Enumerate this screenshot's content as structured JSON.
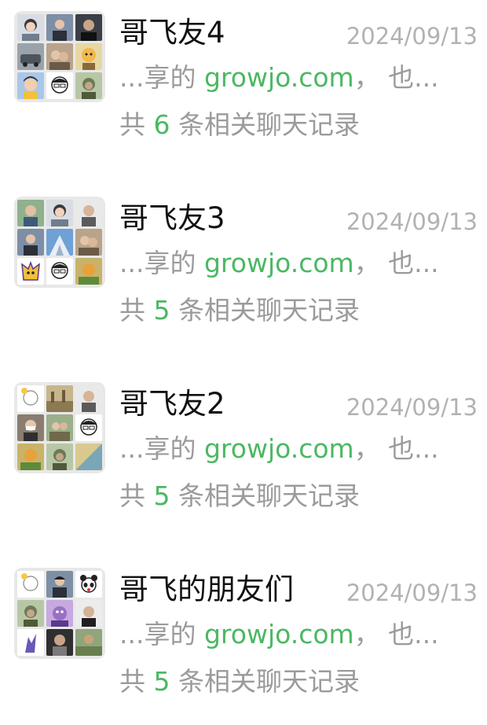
{
  "colors": {
    "highlight": "#4bb862",
    "secondary_text": "#9b9b9b",
    "date_text": "#b2b2b2",
    "title_text": "#111111",
    "avatar_bg": "#e8e8e8"
  },
  "results": [
    {
      "title": "哥飞友4",
      "date": "2024/09/13",
      "snippet_prefix": "...享的 ",
      "snippet_link": "growjo.com",
      "snippet_suffix": "， 也...",
      "count_prefix": "共 ",
      "count": "6",
      "count_suffix": " 条相关聊天记录",
      "avatar_icons": [
        "member-avatar-icon",
        "member-avatar-icon",
        "member-avatar-icon",
        "member-avatar-icon",
        "member-avatar-icon",
        "member-avatar-icon",
        "member-avatar-icon",
        "member-avatar-icon",
        "member-avatar-icon"
      ]
    },
    {
      "title": "哥飞友3",
      "date": "2024/09/13",
      "snippet_prefix": "...享的 ",
      "snippet_link": "growjo.com",
      "snippet_suffix": "， 也...",
      "count_prefix": "共 ",
      "count": "5",
      "count_suffix": " 条相关聊天记录",
      "avatar_icons": [
        "member-avatar-icon",
        "member-avatar-icon",
        "member-avatar-icon",
        "member-avatar-icon",
        "member-avatar-icon",
        "member-avatar-icon",
        "member-avatar-icon",
        "member-avatar-icon",
        "member-avatar-icon"
      ]
    },
    {
      "title": "哥飞友2",
      "date": "2024/09/13",
      "snippet_prefix": "...享的 ",
      "snippet_link": "growjo.com",
      "snippet_suffix": "， 也...",
      "count_prefix": "共 ",
      "count": "5",
      "count_suffix": " 条相关聊天记录",
      "avatar_icons": [
        "member-avatar-icon",
        "member-avatar-icon",
        "member-avatar-icon",
        "member-avatar-icon",
        "member-avatar-icon",
        "member-avatar-icon",
        "member-avatar-icon",
        "member-avatar-icon",
        "member-avatar-icon"
      ]
    },
    {
      "title": "哥飞的朋友们",
      "date": "2024/09/13",
      "snippet_prefix": "...享的 ",
      "snippet_link": "growjo.com",
      "snippet_suffix": "， 也...",
      "count_prefix": "共 ",
      "count": "5",
      "count_suffix": " 条相关聊天记录",
      "avatar_icons": [
        "member-avatar-icon",
        "member-avatar-icon",
        "member-avatar-icon",
        "member-avatar-icon",
        "member-avatar-icon",
        "member-avatar-icon",
        "member-avatar-icon",
        "member-avatar-icon",
        "member-avatar-icon"
      ]
    }
  ]
}
